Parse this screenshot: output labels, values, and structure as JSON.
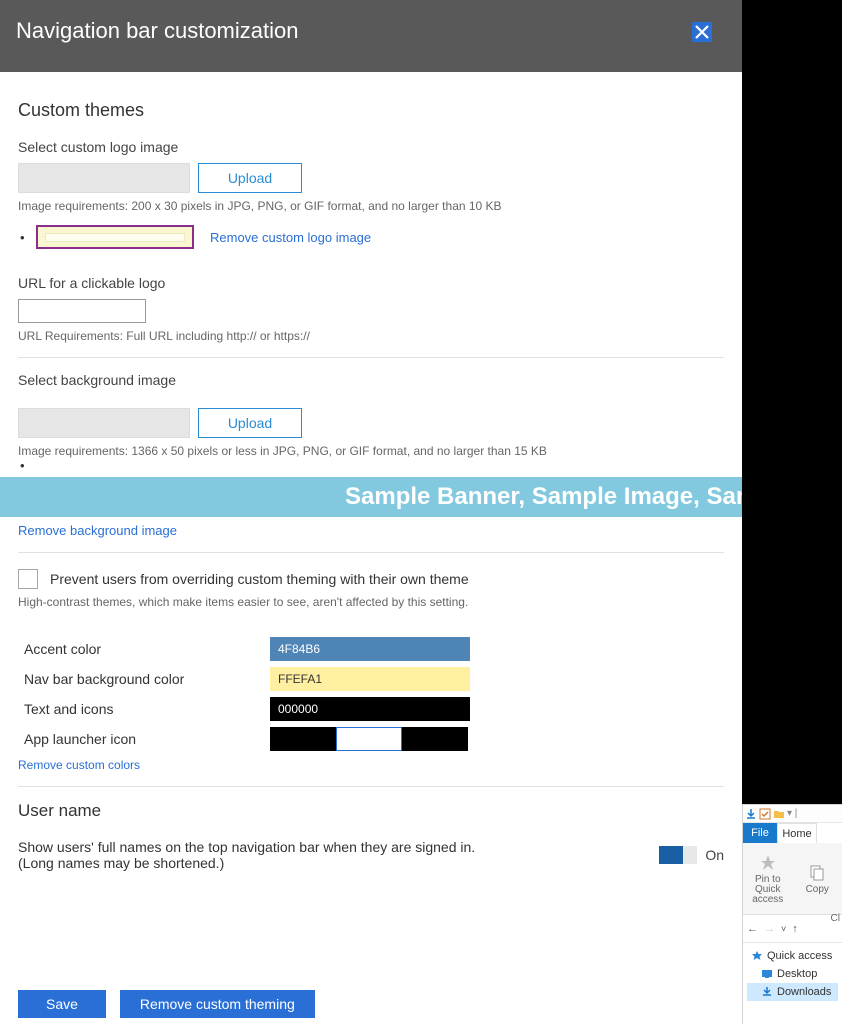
{
  "header": {
    "title": "Navigation bar customization"
  },
  "custom_themes": {
    "heading": "Custom themes",
    "logo_label": "Select custom logo image",
    "upload_label": "Upload",
    "logo_hint": "Image requirements: 200 x 30 pixels in JPG, PNG, or GIF format, and no larger than 10 KB",
    "remove_logo_link": "Remove custom logo image",
    "url_label": "URL for a clickable logo",
    "url_value": "",
    "url_hint": "URL Requirements: Full URL including http:// or https://",
    "bg_label": "Select background image",
    "bg_hint": "Image requirements: 1366 x 50 pixels or less in JPG, PNG, or GIF format, and no larger than 15 KB",
    "banner_text": "Sample Banner, Sample Image, Sam",
    "remove_bg_link": "Remove background image",
    "prevent_label": "Prevent users from overriding custom theming with their own theme",
    "prevent_hint": "High-contrast themes, which make items easier to see, aren't affected by this setting."
  },
  "colors": {
    "accent_label": "Accent color",
    "accent_value": "4F84B6",
    "nav_label": "Nav bar background color",
    "nav_value": "FFEFA1",
    "text_label": "Text and icons",
    "text_value": "000000",
    "launcher_label": "App launcher icon",
    "remove_link": "Remove custom colors"
  },
  "user_name": {
    "heading": "User name",
    "desc1": "Show users' full names on the top navigation bar when they are signed in.",
    "desc2": "(Long names may be shortened.)",
    "toggle_label": "On"
  },
  "footer": {
    "save": "Save",
    "remove": "Remove custom theming"
  },
  "explorer": {
    "file": "File",
    "home": "Home",
    "pin": "Pin to Quick access",
    "copy": "Copy",
    "cl": "Cl",
    "quick": "Quick access",
    "desktop": "Desktop",
    "downloads": "Downloads"
  }
}
